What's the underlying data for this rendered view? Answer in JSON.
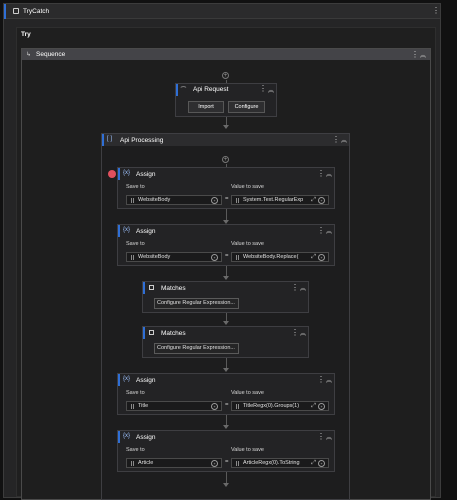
{
  "trycatch": {
    "title": "TryCatch",
    "try_label": "Try"
  },
  "sequence": {
    "title": "Sequence"
  },
  "api_request": {
    "title": "Api Request",
    "import_label": "Import",
    "configure_label": "Configure"
  },
  "api_processing": {
    "title": "Api Processing"
  },
  "assigns": [
    {
      "title": "Assign",
      "save_to_label": "Save to",
      "value_label": "Value to save",
      "target": "WebsiteBody",
      "value": "System.Text.RegularExp"
    },
    {
      "title": "Assign",
      "save_to_label": "Save to",
      "value_label": "Value to save",
      "target": "WebsiteBody",
      "value": "WebsiteBody.Replace("
    },
    {
      "title": "Assign",
      "save_to_label": "Save to",
      "value_label": "Value to save",
      "target": "Title",
      "value": "TitleRegx(0).Groups(1)"
    },
    {
      "title": "Assign",
      "save_to_label": "Save to",
      "value_label": "Value to save",
      "target": "Article",
      "value": "ArticleRegx(0).ToString"
    }
  ],
  "matches": [
    {
      "title": "Matches",
      "configure_label": "Configure Regular Expression..."
    },
    {
      "title": "Matches",
      "configure_label": "Configure Regular Expression..."
    }
  ],
  "icons": {
    "assign": "{x}",
    "plus": "+",
    "dots": "⋮",
    "collapse": "︽",
    "eq": "="
  },
  "colors": {
    "accent": "#2f6fd6",
    "breakpoint": "#e0505e"
  }
}
